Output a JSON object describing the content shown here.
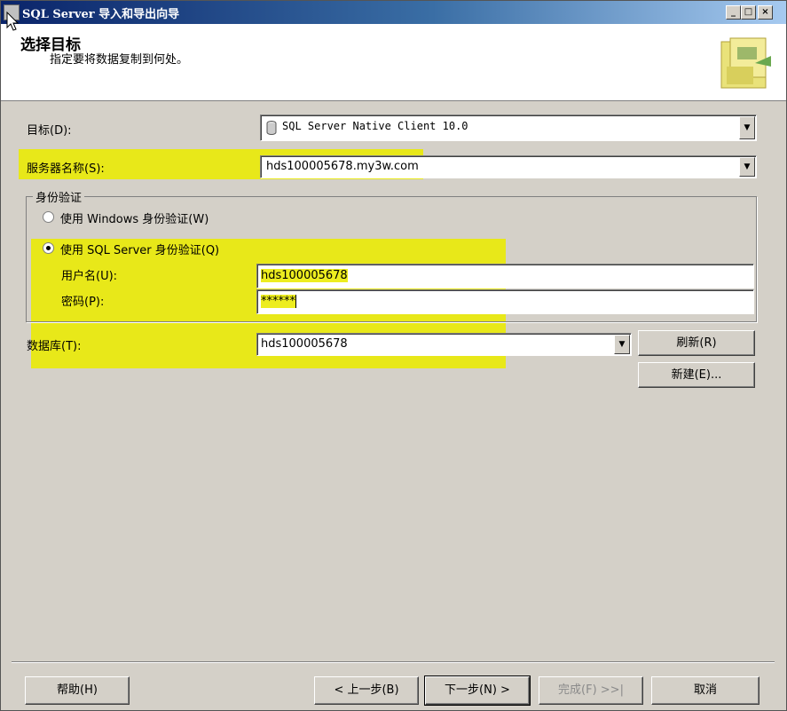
{
  "window": {
    "title": "SQL Server 导入和导出向导"
  },
  "header": {
    "title": "选择目标",
    "subtitle": "指定要将数据复制到何处。"
  },
  "form": {
    "destination_label": "目标(D):",
    "destination_value": "SQL Server Native Client 10.0",
    "server_label": "服务器名称(S):",
    "server_value": "hds100005678.my3w.com",
    "auth_group_label": "身份验证",
    "auth_windows_label": "使用 Windows 身份验证(W)",
    "auth_sql_label": "使用 SQL Server 身份验证(Q)",
    "auth_selected": "sql",
    "username_label": "用户名(U):",
    "username_value": "hds100005678",
    "password_label": "密码(P):",
    "password_value": "******",
    "database_label": "数据库(T):",
    "database_value": "hds100005678",
    "refresh_button": "刷新(R)",
    "new_button": "新建(E)..."
  },
  "footer": {
    "help": "帮助(H)",
    "back": "< 上一步(B)",
    "next": "下一步(N) >",
    "finish": "完成(F) >>|",
    "cancel": "取消"
  },
  "colors": {
    "title_bar": "#0a246a",
    "highlight": "#eaea00",
    "dialog_bg": "#d4d0c8"
  },
  "icons": [
    "wizard-app-icon",
    "minimize-icon",
    "maximize-icon",
    "close-icon",
    "database-icon",
    "dropdown-arrow-icon",
    "wizard-header-graphic",
    "mouse-cursor-icon"
  ]
}
